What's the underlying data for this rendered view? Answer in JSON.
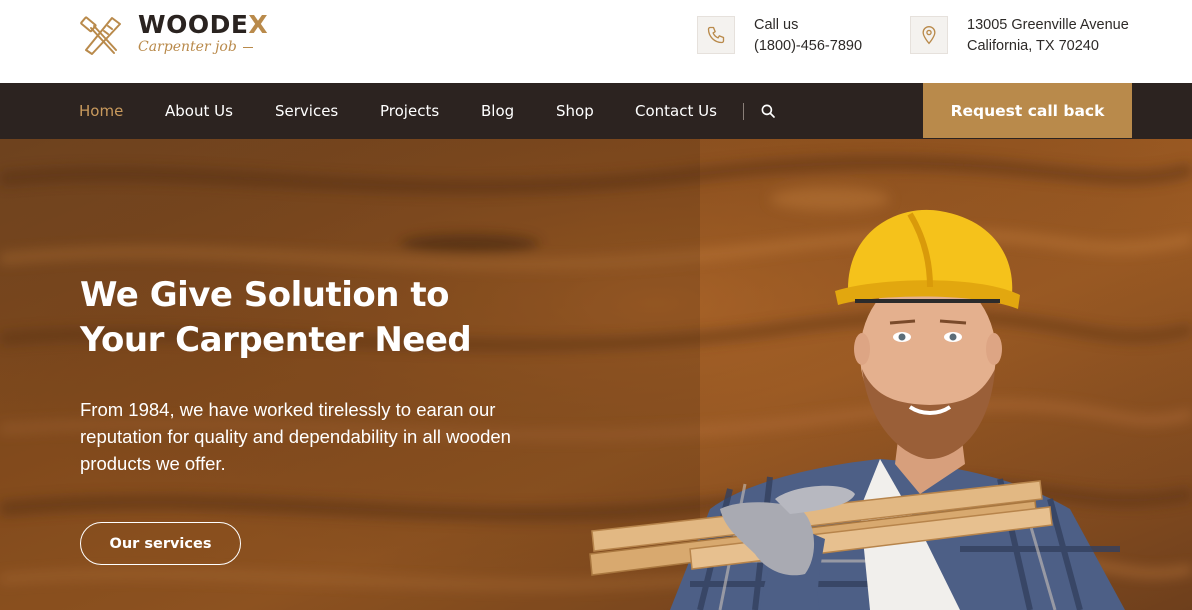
{
  "brand": {
    "name": "WOODEX",
    "tagline": "Carpenter job",
    "icon": "hammer-saw-icon"
  },
  "contact": {
    "phone": {
      "icon": "phone-icon",
      "label": "Call us",
      "value": "(1800)-456-7890"
    },
    "address": {
      "icon": "location-pin-icon",
      "line1": "13005 Greenville Avenue",
      "line2": "California, TX 70240"
    }
  },
  "nav": {
    "items": [
      {
        "label": "Home",
        "active": true
      },
      {
        "label": "About Us"
      },
      {
        "label": "Services"
      },
      {
        "label": "Projects"
      },
      {
        "label": "Blog"
      },
      {
        "label": "Shop"
      },
      {
        "label": "Contact Us"
      }
    ],
    "search_icon": "search-icon",
    "cta_label": "Request call back"
  },
  "hero": {
    "title_line1": "We Give Solution to",
    "title_line2": "Your Carpenter Need",
    "description": "From 1984, we have worked tirelessly to earan our reputation for quality and dependability in all wooden products we offer.",
    "button_label": "Our services"
  },
  "colors": {
    "accent": "#b98a4b",
    "nav_background": "#2c2320",
    "active_nav": "#c99a5d",
    "text_dark": "#2a2320"
  }
}
